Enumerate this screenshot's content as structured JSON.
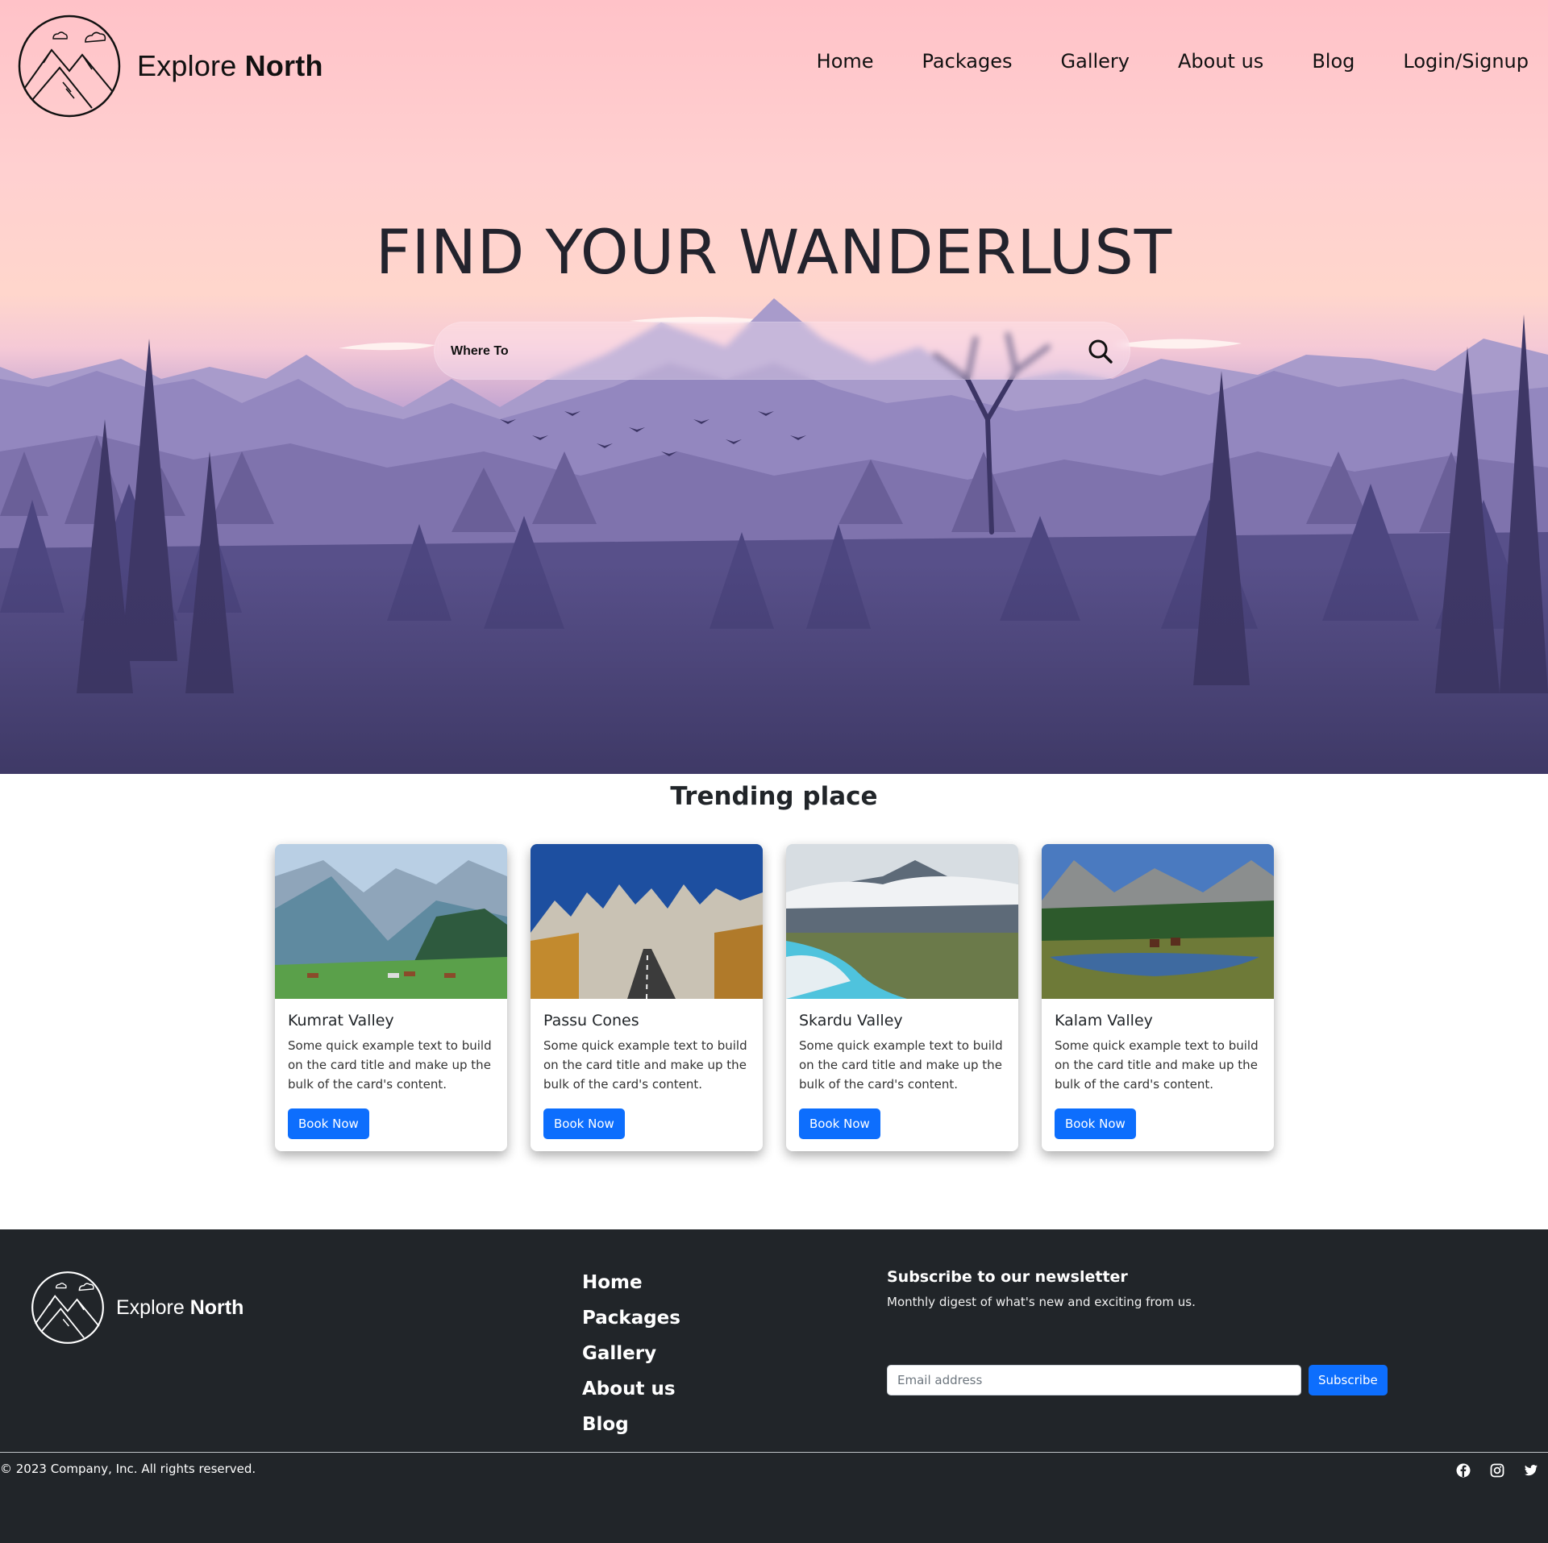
{
  "header": {
    "brand": {
      "first": "Explore",
      "second": "North",
      "logo_icon": "mountain-logo-icon"
    },
    "nav": [
      {
        "label": "Home"
      },
      {
        "label": "Packages"
      },
      {
        "label": "Gallery"
      },
      {
        "label": "About us"
      },
      {
        "label": "Blog"
      },
      {
        "label": "Login/Signup"
      }
    ]
  },
  "hero": {
    "title": "FIND YOUR WANDERLUST",
    "search": {
      "placeholder": "Where To",
      "value": "",
      "icon": "search-icon"
    }
  },
  "trending": {
    "title": "Trending place",
    "cards": [
      {
        "title": "Kumrat Valley",
        "text": "Some quick example text to build on the card title and make up the bulk of the card's content.",
        "button": "Book Now",
        "image": "valley-meadow-horses"
      },
      {
        "title": "Passu Cones",
        "text": "Some quick example text to build on the card title and make up the bulk of the card's content.",
        "button": "Book Now",
        "image": "road-to-peaks"
      },
      {
        "title": "Skardu Valley",
        "text": "Some quick example text to build on the card title and make up the bulk of the card's content.",
        "button": "Book Now",
        "image": "river-valley-clouds"
      },
      {
        "title": "Kalam Valley",
        "text": "Some quick example text to build on the card title and make up the bulk of the card's content.",
        "button": "Book Now",
        "image": "lake-forest-riders"
      }
    ]
  },
  "footer": {
    "brand": {
      "first": "Explore",
      "second": "North"
    },
    "links": [
      {
        "label": "Home"
      },
      {
        "label": "Packages"
      },
      {
        "label": "Gallery"
      },
      {
        "label": "About us"
      },
      {
        "label": "Blog"
      }
    ],
    "newsletter": {
      "title": "Subscribe to our newsletter",
      "subtitle": "Monthly digest of what's new and exciting from us.",
      "email_placeholder": "Email address",
      "button": "Subscribe"
    },
    "copyright": "© 2023 Company, Inc. All rights reserved.",
    "socials": [
      "facebook-icon",
      "instagram-icon",
      "twitter-icon"
    ]
  },
  "colors": {
    "primary": "#0d6efd",
    "footer_bg": "#212529",
    "hero_top": "#ffc2c8",
    "hero_bottom": "#3d3a5e"
  }
}
